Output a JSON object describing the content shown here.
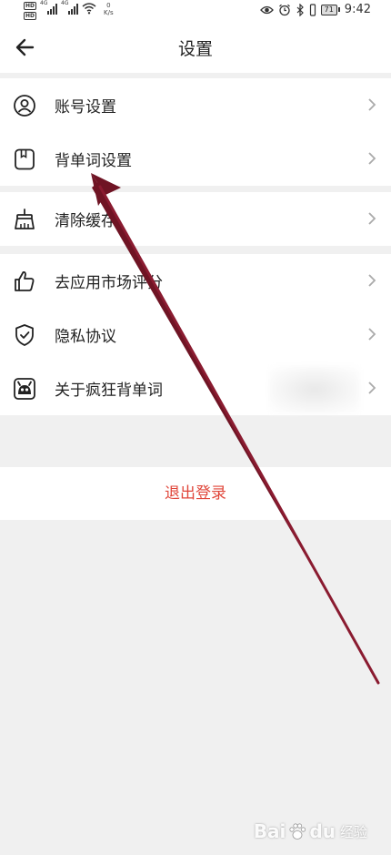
{
  "status_bar": {
    "left_tags": [
      "HD",
      "HD"
    ],
    "net_gen_1": "4G",
    "net_gen_2": "4G",
    "speed_value": "0",
    "speed_unit": "K/s",
    "battery": "71",
    "time": "9:42"
  },
  "header": {
    "title": "设置"
  },
  "groups": {
    "account": {
      "label": "账号设置"
    },
    "words": {
      "label": "背单词设置"
    },
    "cache": {
      "label": "清除缓存"
    },
    "rate": {
      "label": "去应用市场评分"
    },
    "privacy": {
      "label": "隐私协议"
    },
    "about": {
      "label": "关于疯狂背单词"
    }
  },
  "logout": {
    "label": "退出登录"
  },
  "watermark": {
    "brand": "Bai",
    "brand2": "du",
    "suffix": "经验"
  },
  "colors": {
    "accent_red": "#e0463a",
    "annotation_arrow": "#7a1a2a",
    "page_bg": "#f0f0f0"
  }
}
